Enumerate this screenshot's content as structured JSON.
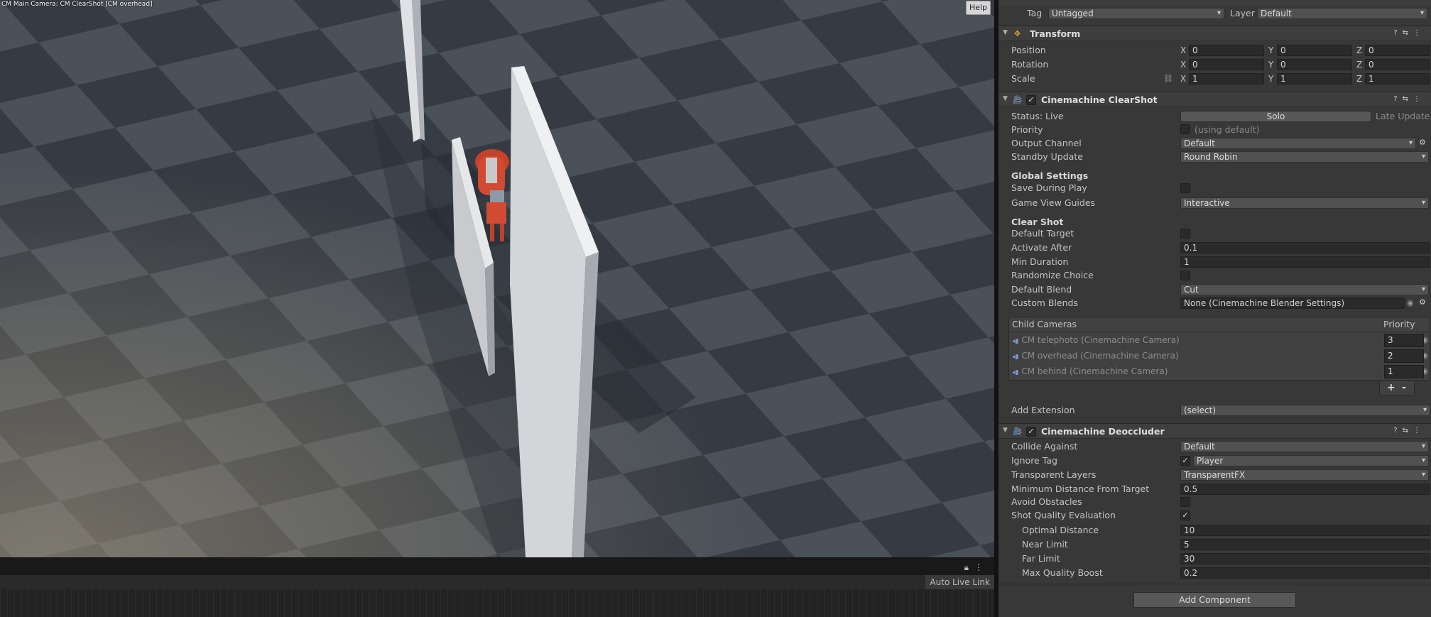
{
  "scene": {
    "caption": "CM Main Camera: CM ClearShot [CM overhead]",
    "help_label": "Help"
  },
  "timeline": {
    "auto_live_link": "Auto Live Link"
  },
  "inspector": {
    "tag_label": "Tag",
    "tag_value": "Untagged",
    "layer_label": "Layer",
    "layer_value": "Default",
    "transform": {
      "title": "Transform",
      "rows": [
        {
          "label": "Position",
          "x": "0",
          "y": "0",
          "z": "0"
        },
        {
          "label": "Rotation",
          "x": "0",
          "y": "0",
          "z": "0"
        },
        {
          "label": "Scale",
          "x": "1",
          "y": "1",
          "z": "1"
        }
      ],
      "axis_x": "X",
      "axis_y": "Y",
      "axis_z": "Z"
    },
    "clearshot": {
      "title": "Cinemachine ClearShot",
      "status_label": "Status: Live",
      "solo_label": "Solo",
      "late_update": "Late Update",
      "priority_label": "Priority",
      "priority_hint": "(using default)",
      "output_channel_label": "Output Channel",
      "output_channel_value": "Default",
      "standby_label": "Standby Update",
      "standby_value": "Round Robin",
      "global_settings": "Global Settings",
      "save_during_play": "Save During Play",
      "game_view_guides_label": "Game View Guides",
      "game_view_guides_value": "Interactive",
      "clear_shot": "Clear Shot",
      "default_target": "Default Target",
      "activate_after_label": "Activate After",
      "activate_after_value": "0.1",
      "min_duration_label": "Min Duration",
      "min_duration_value": "1",
      "randomize_choice": "Randomize Choice",
      "default_blend_label": "Default Blend",
      "default_blend_value": "Cut",
      "custom_blends_label": "Custom Blends",
      "custom_blends_value": "None (Cinemachine Blender Settings)",
      "child_cameras_label": "Child Cameras",
      "priority_col": "Priority",
      "child_cameras": [
        {
          "name": "CM telephoto (Cinemachine Camera)",
          "priority": "3"
        },
        {
          "name": "CM overhead (Cinemachine Camera)",
          "priority": "2"
        },
        {
          "name": "CM behind (Cinemachine Camera)",
          "priority": "1"
        }
      ],
      "plus": "+",
      "minus": "-",
      "add_extension_label": "Add Extension",
      "add_extension_value": "(select)"
    },
    "deoccluder": {
      "title": "Cinemachine Deoccluder",
      "collide_against_label": "Collide Against",
      "collide_against_value": "Default",
      "ignore_tag_label": "Ignore Tag",
      "ignore_tag_value": "Player",
      "transparent_layers_label": "Transparent Layers",
      "transparent_layers_value": "TransparentFX",
      "min_distance_label": "Minimum Distance From Target",
      "min_distance_value": "0.5",
      "avoid_obstacles": "Avoid Obstacles",
      "shot_quality": "Shot Quality Evaluation",
      "optimal_distance_label": "Optimal Distance",
      "optimal_distance_value": "10",
      "near_limit_label": "Near Limit",
      "near_limit_value": "5",
      "far_limit_label": "Far Limit",
      "far_limit_value": "30",
      "max_quality_label": "Max Quality Boost",
      "max_quality_value": "0.2"
    },
    "add_component": "Add Component"
  }
}
